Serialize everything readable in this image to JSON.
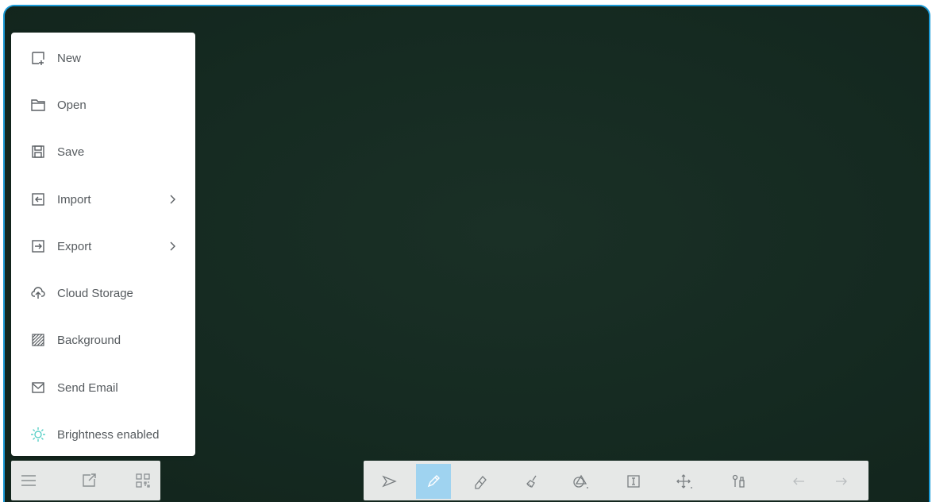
{
  "menu": {
    "items": [
      {
        "label": "New",
        "icon": "new-file-icon"
      },
      {
        "label": "Open",
        "icon": "folder-icon"
      },
      {
        "label": "Save",
        "icon": "save-icon"
      },
      {
        "label": "Import",
        "icon": "import-icon",
        "submenu": true
      },
      {
        "label": "Export",
        "icon": "export-icon",
        "submenu": true
      },
      {
        "label": "Cloud Storage",
        "icon": "cloud-upload-icon"
      },
      {
        "label": "Background",
        "icon": "background-icon"
      },
      {
        "label": "Send Email",
        "icon": "mail-icon"
      },
      {
        "label": "Brightness enabled",
        "icon": "brightness-icon"
      }
    ]
  },
  "left_toolbar": [
    "menu-icon",
    "share-icon",
    "qr-code-icon"
  ],
  "toolbar": {
    "tools": [
      "select-icon",
      "pen-icon",
      "eraser-icon",
      "clear-icon",
      "shape-icon",
      "text-box-icon",
      "move-icon",
      "tools-icon",
      "undo-icon",
      "redo-icon"
    ],
    "active_tool": "pen-icon"
  },
  "colors": {
    "board": "#15291f",
    "frame_border": "#1a9ad6",
    "active_tool": "#9fd3f0",
    "brightness_icon": "#5bd0c8",
    "toolbar_bg": "#e6e8e7"
  }
}
